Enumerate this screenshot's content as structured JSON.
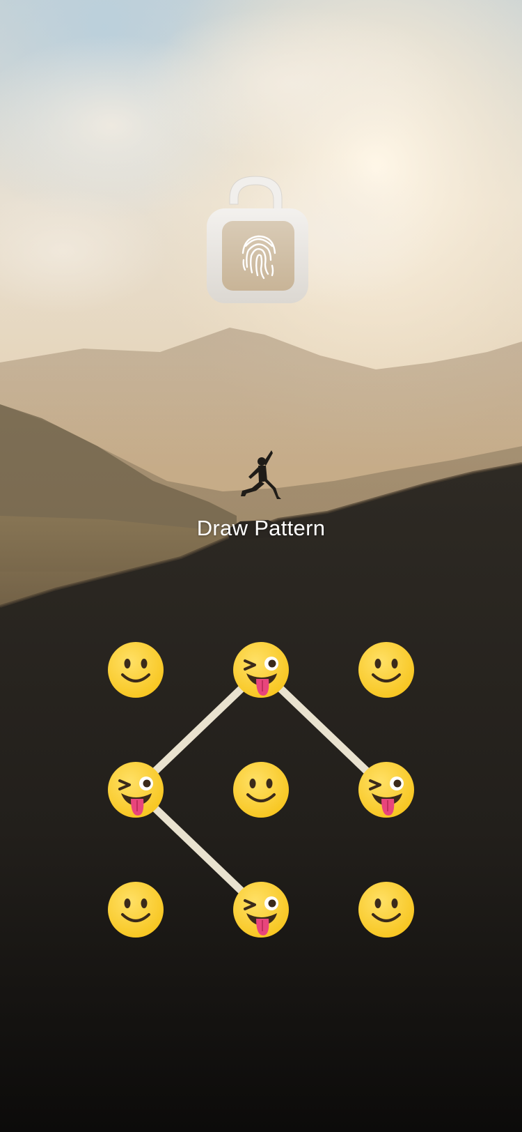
{
  "screen": {
    "title": "Draw Pattern"
  },
  "lock": {
    "icon": "padlock-fingerprint-icon"
  },
  "pattern": {
    "grid_size": 3,
    "nodes": [
      {
        "row": 0,
        "col": 0,
        "icon": "smiling-face-icon",
        "selected": false
      },
      {
        "row": 0,
        "col": 1,
        "icon": "winking-tongue-face-icon",
        "selected": true
      },
      {
        "row": 0,
        "col": 2,
        "icon": "smiling-face-icon",
        "selected": false
      },
      {
        "row": 1,
        "col": 0,
        "icon": "winking-tongue-face-icon",
        "selected": true
      },
      {
        "row": 1,
        "col": 1,
        "icon": "smiling-face-icon",
        "selected": false
      },
      {
        "row": 1,
        "col": 2,
        "icon": "winking-tongue-face-icon",
        "selected": true
      },
      {
        "row": 2,
        "col": 0,
        "icon": "smiling-face-icon",
        "selected": false
      },
      {
        "row": 2,
        "col": 1,
        "icon": "winking-tongue-face-icon",
        "selected": true
      },
      {
        "row": 2,
        "col": 2,
        "icon": "smiling-face-icon",
        "selected": false
      }
    ],
    "path": [
      5,
      1,
      3,
      7
    ],
    "line_color": "#e9e2cf"
  },
  "colors": {
    "emoji_yellow": "#f7c51e",
    "tongue_pink": "#e8457c"
  }
}
